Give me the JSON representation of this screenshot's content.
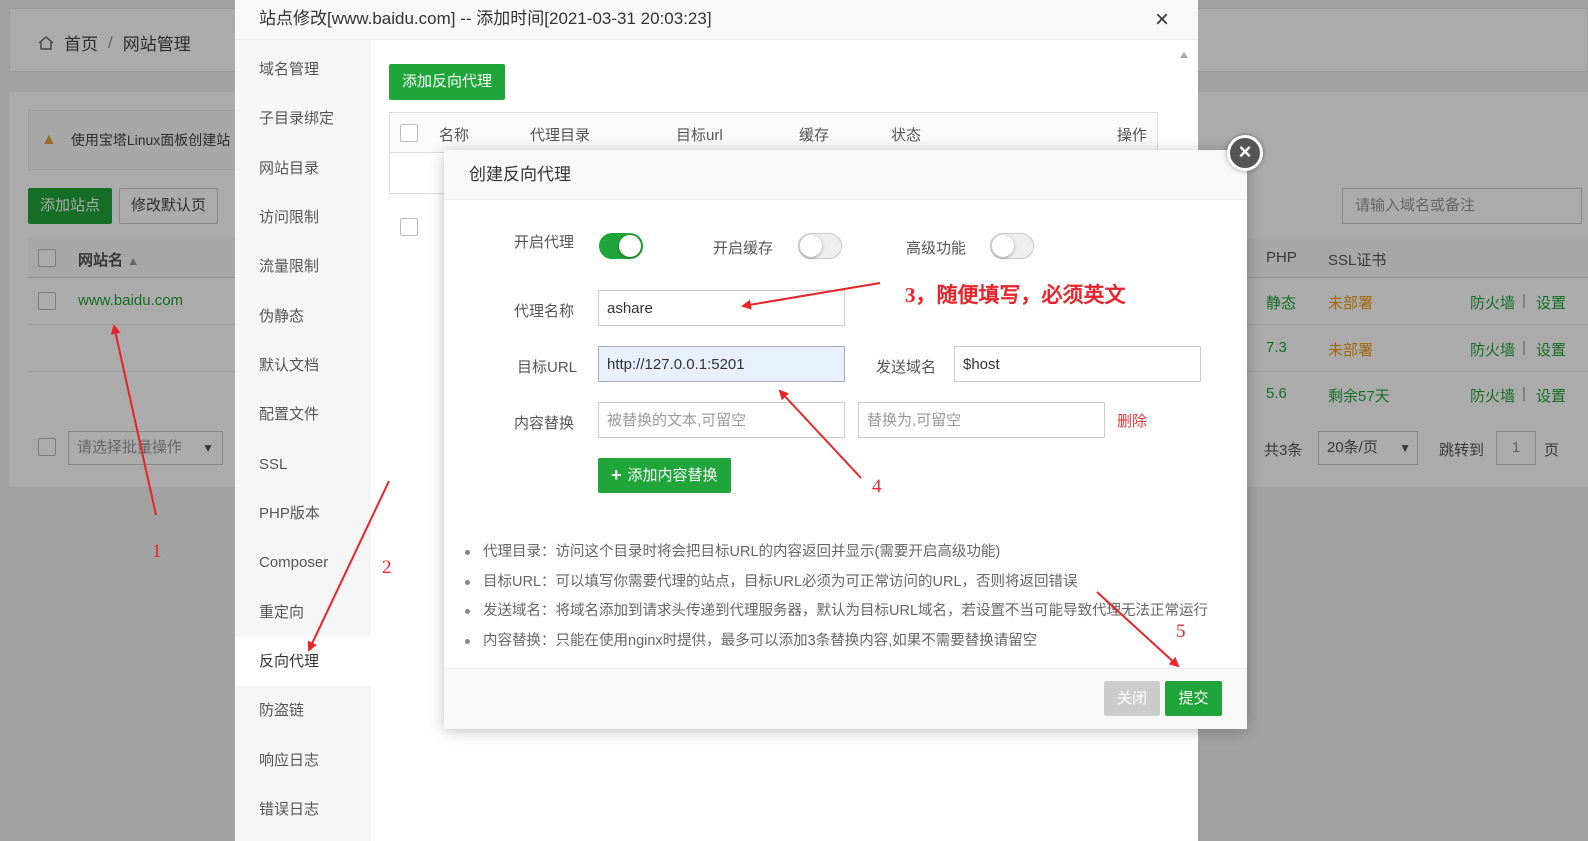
{
  "background": {
    "breadcrumb": {
      "home": "首页",
      "separator": "/",
      "current": "网站管理"
    },
    "alert_text": "使用宝塔Linux面板创建站",
    "buttons": {
      "add_site": "添加站点",
      "modify_default": "修改默认页"
    },
    "search_placeholder": "请输入域名或备注",
    "table": {
      "col_site": "网站名",
      "col_php": "PHP",
      "col_ssl": "SSL证书",
      "rows": [
        {
          "site": "www.baidu.com",
          "php": "静态",
          "ssl": "未部署",
          "firewall": "防火墙",
          "sep": "|",
          "settings": "设置"
        },
        {
          "site": "",
          "php": "7.3",
          "ssl": "未部署",
          "firewall": "防火墙",
          "sep": "|",
          "settings": "设置"
        },
        {
          "site": "",
          "php": "5.6",
          "ssl": "剩余57天",
          "firewall": "防火墙",
          "sep": "|",
          "settings": "设置"
        }
      ]
    },
    "batch_placeholder": "请选择批量操作",
    "pager": {
      "total": "共3条",
      "per_page": "20条/页",
      "jump_label": "跳转到",
      "page_value": "1",
      "page_suffix": "页"
    }
  },
  "site_modal": {
    "title": "站点修改[www.baidu.com] -- 添加时间[2021-03-31 20:03:23]",
    "close": "×",
    "sidebar": [
      "域名管理",
      "子目录绑定",
      "网站目录",
      "访问限制",
      "流量限制",
      "伪静态",
      "默认文档",
      "配置文件",
      "SSL",
      "PHP版本",
      "Composer",
      "重定向",
      "反向代理",
      "防盗链",
      "响应日志",
      "错误日志"
    ],
    "active_item": "反向代理",
    "add_proxy_button": "添加反向代理",
    "proxy_table_headers": {
      "name": "名称",
      "dir": "代理目录",
      "target": "目标url",
      "cache": "缓存",
      "status": "状态",
      "action": "操作"
    }
  },
  "dialog": {
    "title": "创建反向代理",
    "close": "×",
    "toggles": {
      "enable_proxy": {
        "label": "开启代理",
        "on": true
      },
      "enable_cache": {
        "label": "开启缓存",
        "on": false
      },
      "advanced": {
        "label": "高级功能",
        "on": false
      }
    },
    "proxy_name": {
      "label": "代理名称",
      "value": "ashare"
    },
    "target_url": {
      "label": "目标URL",
      "value": "http://127.0.0.1:5201"
    },
    "send_domain": {
      "label": "发送域名",
      "value": "$host"
    },
    "content_replace": {
      "label": "内容替换",
      "from_placeholder": "被替换的文本,可留空",
      "to_placeholder": "替换为,可留空",
      "delete": "删除"
    },
    "add_replace_button": "添加内容替换",
    "tips": [
      "代理目录：访问这个目录时将会把目标URL的内容返回并显示(需要开启高级功能)",
      "目标URL：可以填写你需要代理的站点，目标URL必须为可正常访问的URL，否则将返回错误",
      "发送域名：将域名添加到请求头传递到代理服务器，默认为目标URL域名，若设置不当可能导致代理无法正常运行",
      "内容替换：只能在使用nginx时提供，最多可以添加3条替换内容,如果不需要替换请留空"
    ],
    "buttons": {
      "close": "关闭",
      "submit": "提交"
    }
  },
  "annotations": {
    "n1": "1",
    "n2": "2",
    "n3": "3，随便填写，必须英文",
    "n4": "4",
    "n5": "5",
    "color": "#e8232a"
  }
}
